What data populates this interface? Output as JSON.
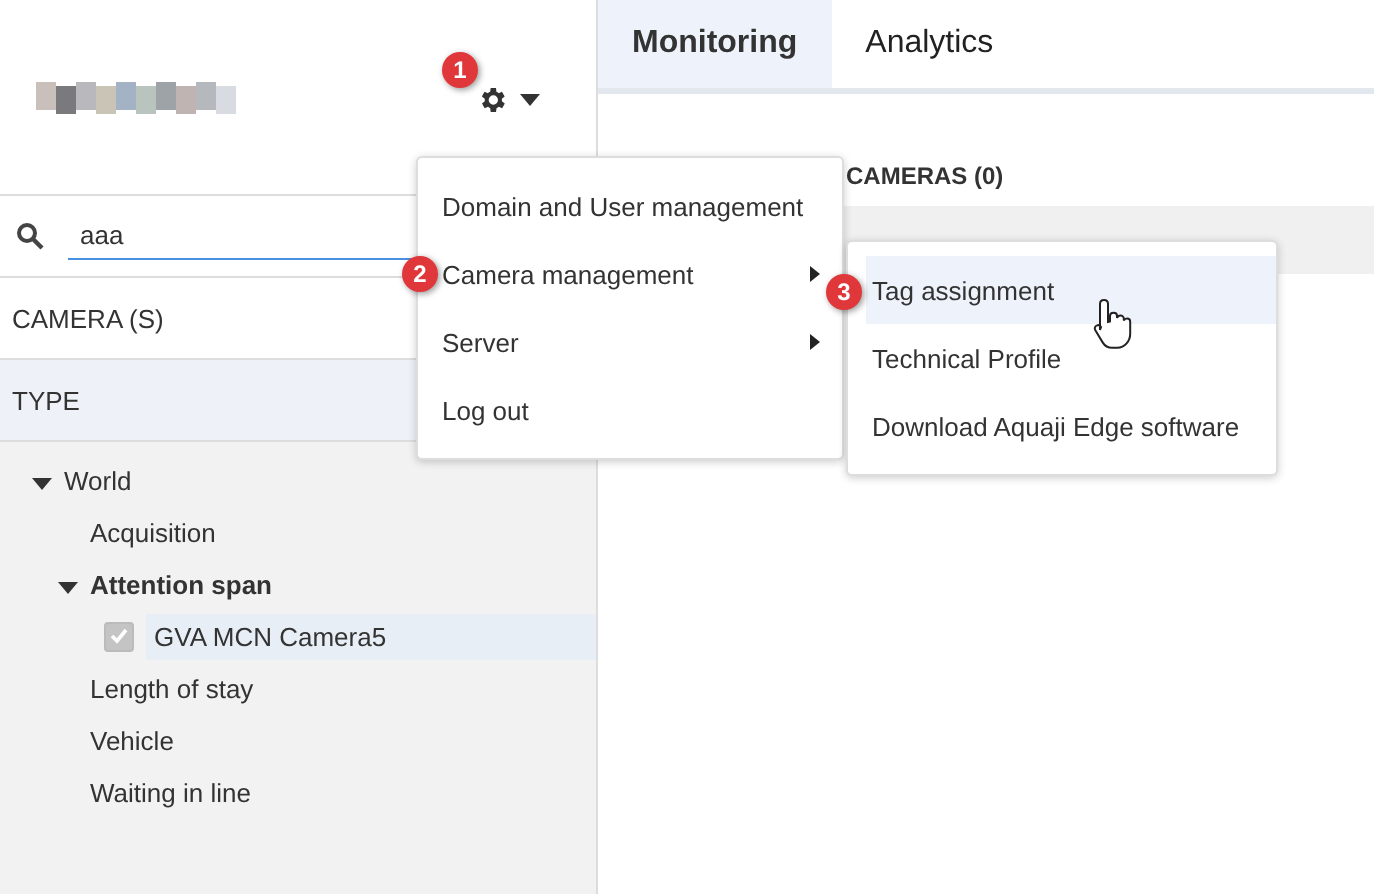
{
  "search": {
    "value": "aaa"
  },
  "sidebar": {
    "camera_header": "CAMERA (S)",
    "type_header": "TYPE",
    "tree": [
      {
        "label": "World",
        "kind": "group",
        "expanded": true,
        "bold": false,
        "children": [
          {
            "label": "Acquisition",
            "kind": "node"
          },
          {
            "label": "Attention span",
            "kind": "group",
            "expanded": true,
            "bold": true,
            "children": [
              {
                "label": "GVA MCN Camera5",
                "kind": "camera",
                "checked": true,
                "selected": true
              }
            ]
          },
          {
            "label": "Length of stay",
            "kind": "node"
          },
          {
            "label": "Vehicle",
            "kind": "node"
          },
          {
            "label": "Waiting in line",
            "kind": "node"
          }
        ]
      }
    ]
  },
  "tabs": [
    {
      "label": "Monitoring",
      "selected": true
    },
    {
      "label": "Analytics",
      "selected": false
    }
  ],
  "cameras_title": "CAMERAS (0)",
  "menu": {
    "items": [
      {
        "label": "Domain and User management",
        "submenu": false
      },
      {
        "label": "Camera management",
        "submenu": true,
        "badge": "2"
      },
      {
        "label": "Server",
        "submenu": true
      },
      {
        "label": "Log out",
        "submenu": false
      }
    ]
  },
  "submenu": {
    "items": [
      {
        "label": "Tag assignment",
        "highlighted": true,
        "badge": "3"
      },
      {
        "label": "Technical Profile",
        "highlighted": false
      },
      {
        "label": "Download Aquaji Edge software",
        "highlighted": false
      }
    ]
  },
  "gear_badge": "1"
}
